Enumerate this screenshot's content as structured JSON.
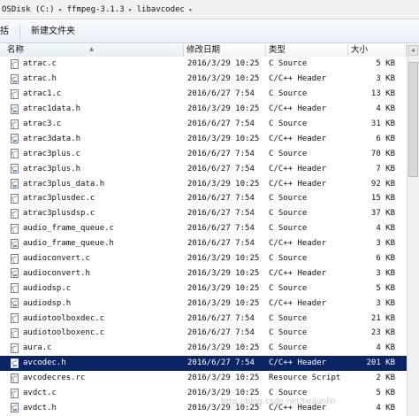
{
  "address": {
    "segments": [
      "OSDisk (C:)",
      "ffmpeg-3.1.3",
      "libavcodec"
    ],
    "separator": "▸"
  },
  "toolbar": {
    "include_label": "包含到库中",
    "include_visible": "括",
    "new_folder": "新建文件夹"
  },
  "columns": {
    "name": "名称",
    "date": "修改日期",
    "type": "类型",
    "size": "大小",
    "sort_arrow": "▲"
  },
  "files": [
    {
      "name": "atrac.c",
      "date": "2016/3/29 10:25",
      "type": "C Source",
      "size": "5 KB",
      "icon": "c-source-file-icon"
    },
    {
      "name": "atrac.h",
      "date": "2016/3/29 10:25",
      "type": "C/C++ Header",
      "size": "3 KB",
      "icon": "header-file-icon"
    },
    {
      "name": "atrac1.c",
      "date": "2016/6/27 7:54",
      "type": "C Source",
      "size": "13 KB",
      "icon": "c-source-file-icon"
    },
    {
      "name": "atrac1data.h",
      "date": "2016/3/29 10:25",
      "type": "C/C++ Header",
      "size": "4 KB",
      "icon": "header-file-icon"
    },
    {
      "name": "atrac3.c",
      "date": "2016/6/27 7:54",
      "type": "C Source",
      "size": "31 KB",
      "icon": "c-source-file-icon"
    },
    {
      "name": "atrac3data.h",
      "date": "2016/3/29 10:25",
      "type": "C/C++ Header",
      "size": "6 KB",
      "icon": "header-file-icon"
    },
    {
      "name": "atrac3plus.c",
      "date": "2016/6/27 7:54",
      "type": "C Source",
      "size": "70 KB",
      "icon": "c-source-file-icon"
    },
    {
      "name": "atrac3plus.h",
      "date": "2016/6/27 7:54",
      "type": "C/C++ Header",
      "size": "7 KB",
      "icon": "header-file-icon"
    },
    {
      "name": "atrac3plus_data.h",
      "date": "2016/3/29 10:25",
      "type": "C/C++ Header",
      "size": "92 KB",
      "icon": "header-file-icon"
    },
    {
      "name": "atrac3plusdec.c",
      "date": "2016/6/27 7:54",
      "type": "C Source",
      "size": "15 KB",
      "icon": "c-source-file-icon"
    },
    {
      "name": "atrac3plusdsp.c",
      "date": "2016/6/27 7:54",
      "type": "C Source",
      "size": "37 KB",
      "icon": "c-source-file-icon"
    },
    {
      "name": "audio_frame_queue.c",
      "date": "2016/6/27 7:54",
      "type": "C Source",
      "size": "4 KB",
      "icon": "c-source-file-icon"
    },
    {
      "name": "audio_frame_queue.h",
      "date": "2016/6/27 7:54",
      "type": "C/C++ Header",
      "size": "3 KB",
      "icon": "header-file-icon"
    },
    {
      "name": "audioconvert.c",
      "date": "2016/3/29 10:25",
      "type": "C Source",
      "size": "6 KB",
      "icon": "c-source-file-icon"
    },
    {
      "name": "audioconvert.h",
      "date": "2016/3/29 10:25",
      "type": "C/C++ Header",
      "size": "3 KB",
      "icon": "header-file-icon"
    },
    {
      "name": "audiodsp.c",
      "date": "2016/3/29 10:25",
      "type": "C Source",
      "size": "5 KB",
      "icon": "c-source-file-icon"
    },
    {
      "name": "audiodsp.h",
      "date": "2016/3/29 10:25",
      "type": "C/C++ Header",
      "size": "3 KB",
      "icon": "header-file-icon"
    },
    {
      "name": "audiotoolboxdec.c",
      "date": "2016/6/27 7:54",
      "type": "C Source",
      "size": "21 KB",
      "icon": "c-source-file-icon"
    },
    {
      "name": "audiotoolboxenc.c",
      "date": "2016/6/27 7:54",
      "type": "C Source",
      "size": "23 KB",
      "icon": "c-source-file-icon"
    },
    {
      "name": "aura.c",
      "date": "2016/3/29 10:25",
      "type": "C Source",
      "size": "4 KB",
      "icon": "c-source-file-icon"
    },
    {
      "name": "avcodec.h",
      "date": "2016/6/27 7:54",
      "type": "C/C++ Header",
      "size": "201 KB",
      "icon": "header-file-icon",
      "selected": true
    },
    {
      "name": "avcodecres.rc",
      "date": "2016/3/29 10:25",
      "type": "Resource Script",
      "size": "2 KB",
      "icon": "resource-file-icon"
    },
    {
      "name": "avdct.c",
      "date": "2016/3/29 10:25",
      "type": "C Source",
      "size": "5 KB",
      "icon": "c-source-file-icon"
    },
    {
      "name": "avdct.h",
      "date": "2016/3/29 10:25",
      "type": "C/C++ Header",
      "size": "4 KB",
      "icon": "header-file-icon"
    }
  ],
  "watermark": "http://blog.csdn.net/hejjunlin",
  "colors": {
    "selection": "#0a2466",
    "header_bg": "#ffffff"
  }
}
